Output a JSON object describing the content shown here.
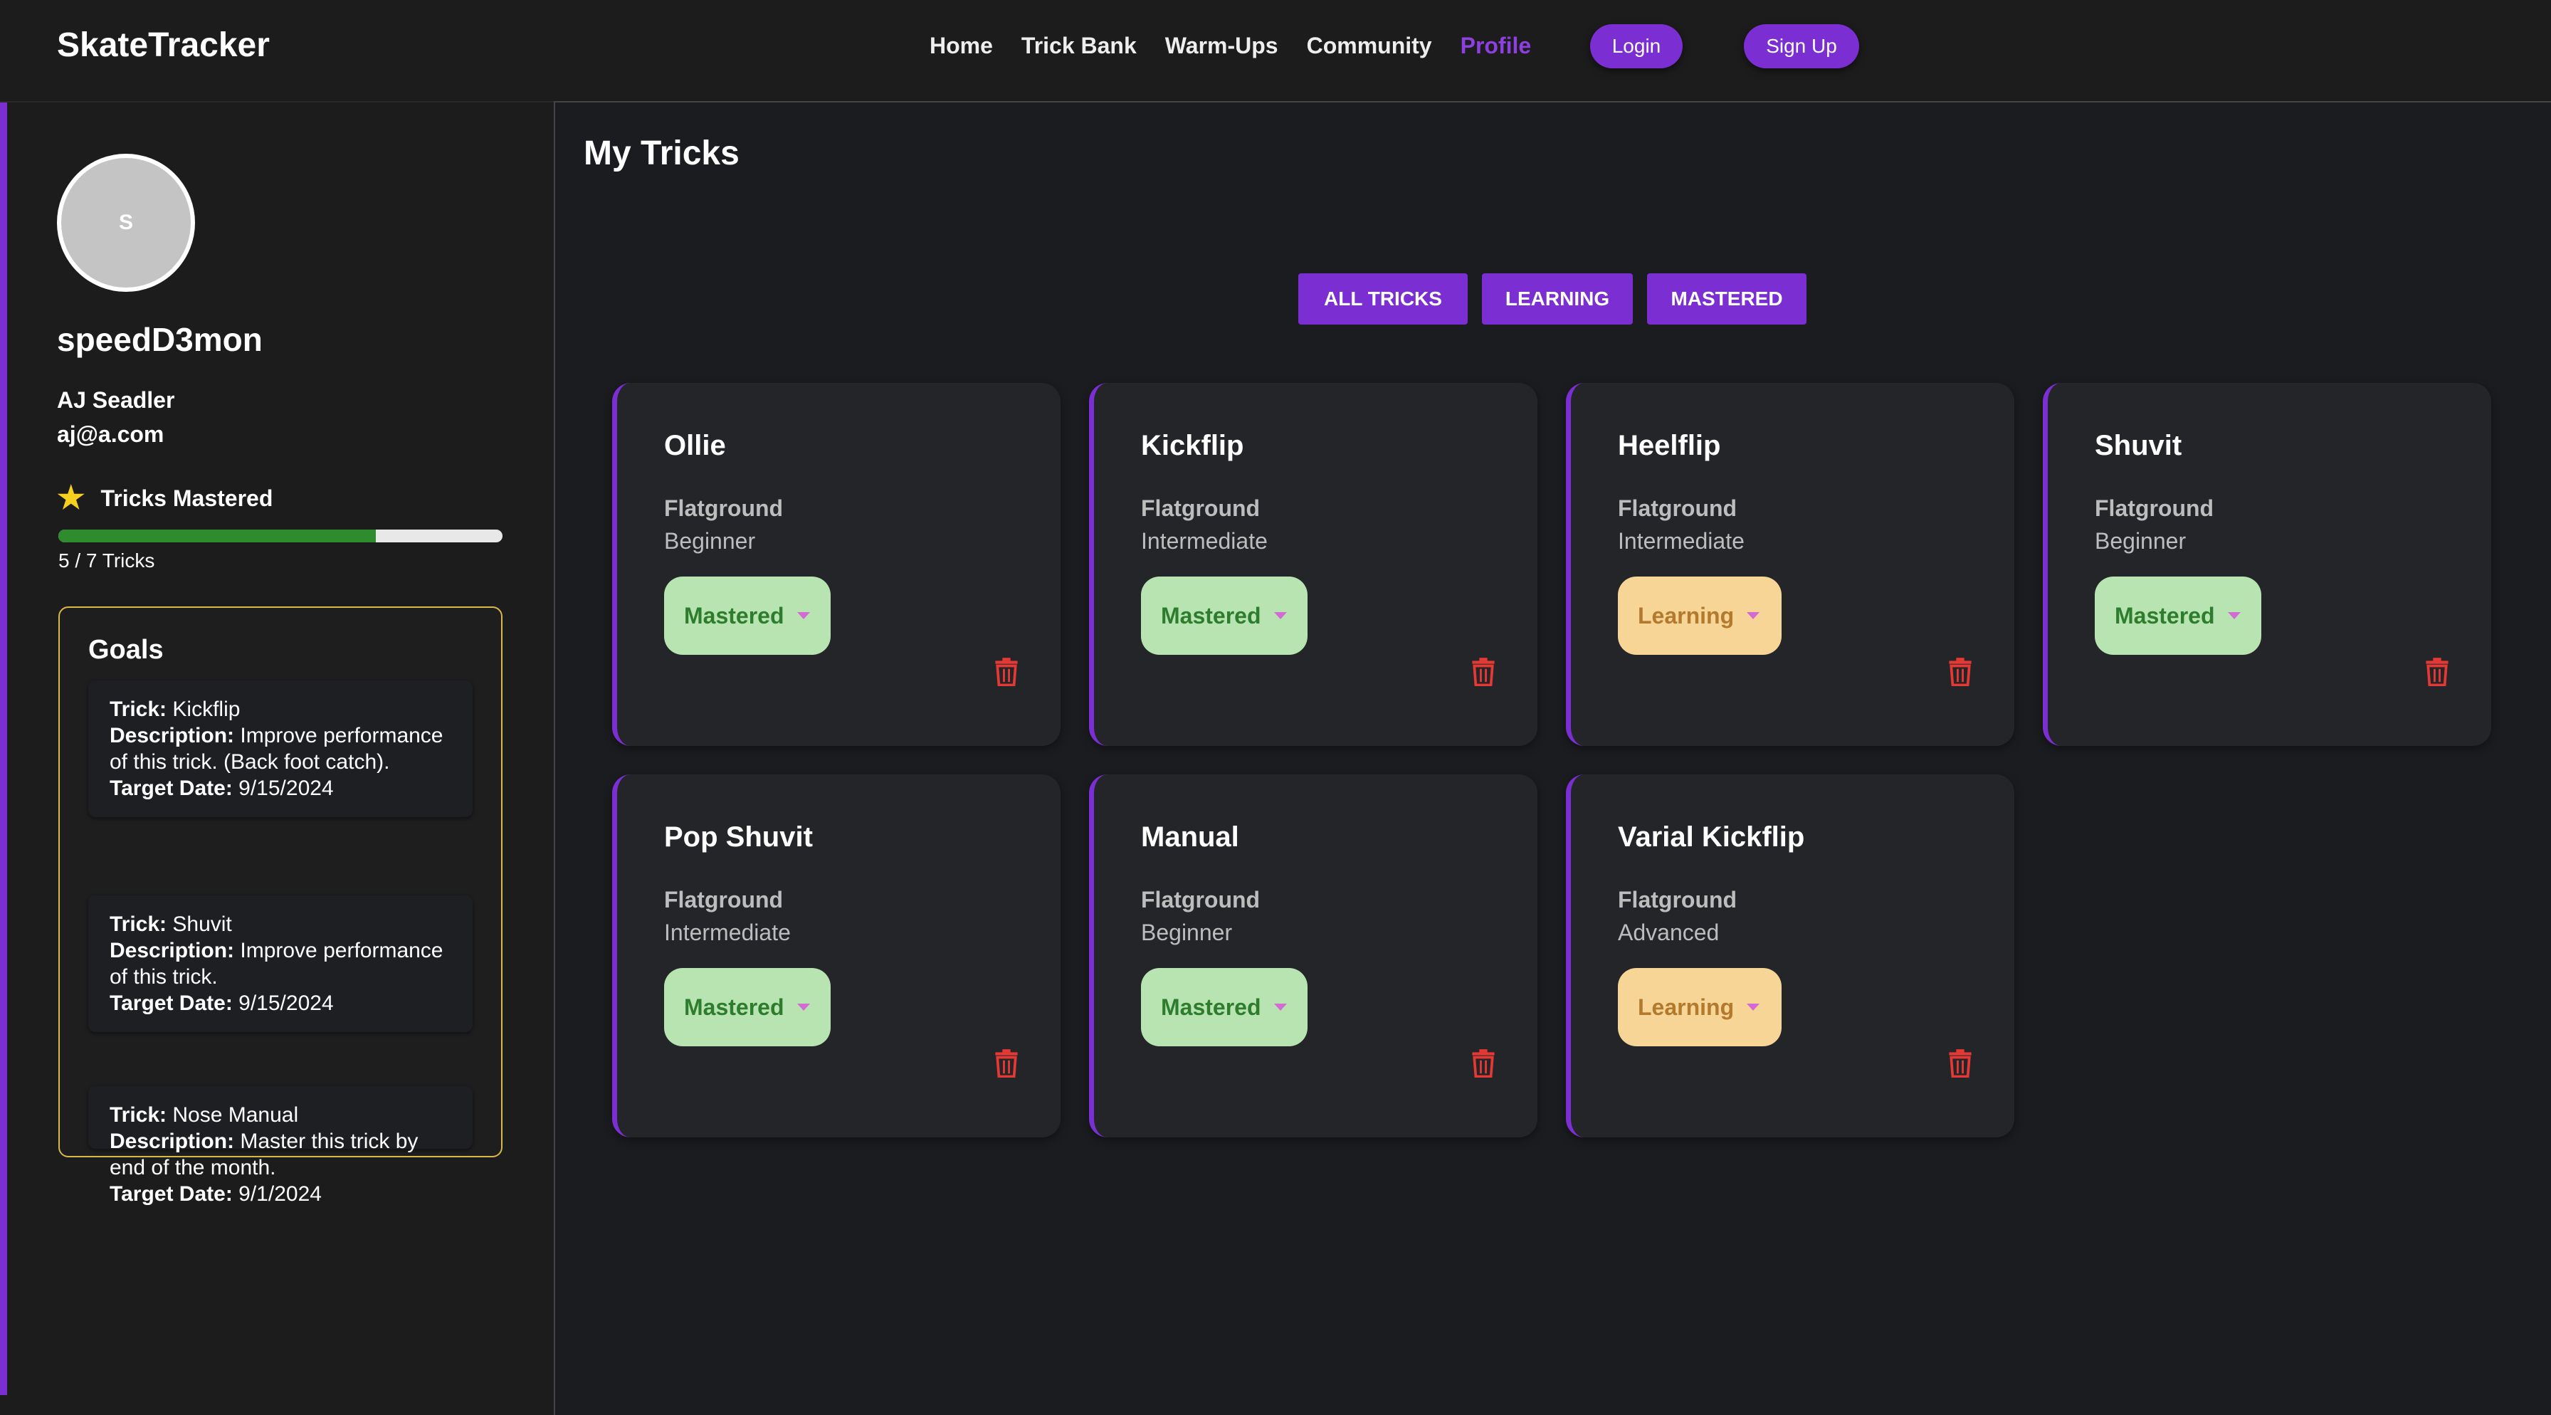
{
  "brand": "SkateTracker",
  "nav": [
    "Home",
    "Trick Bank",
    "Warm-Ups",
    "Community",
    "Profile"
  ],
  "auth": {
    "login": "Login",
    "signup": "Sign Up"
  },
  "profile": {
    "avatar_initial": "S",
    "username": "speedD3mon",
    "full_name": "AJ Seadler",
    "email": "aj@a.com",
    "mastered_label": "Tricks Mastered",
    "mastered_count": 5,
    "total_count": 7,
    "progress_text": "5 / 7 Tricks"
  },
  "goals": {
    "title": "Goals",
    "items": [
      {
        "trick": "Kickflip",
        "description": "Improve performance of this trick. (Back foot catch).",
        "target_date": "9/15/2024"
      },
      {
        "trick": "Shuvit",
        "description": "Improve performance of this trick.",
        "target_date": "9/15/2024"
      },
      {
        "trick": "Nose Manual",
        "description": "Master this trick by end of the month.",
        "target_date": "9/1/2024"
      }
    ],
    "labels": {
      "trick": "Trick:",
      "description": "Description:",
      "target_date": "Target Date:"
    }
  },
  "main": {
    "title": "My Tricks",
    "filters": [
      "ALL TRICKS",
      "LEARNING",
      "MASTERED"
    ]
  },
  "tricks": [
    {
      "name": "Ollie",
      "category": "Flatground",
      "level": "Beginner",
      "status": "Mastered"
    },
    {
      "name": "Kickflip",
      "category": "Flatground",
      "level": "Intermediate",
      "status": "Mastered"
    },
    {
      "name": "Heelflip",
      "category": "Flatground",
      "level": "Intermediate",
      "status": "Learning"
    },
    {
      "name": "Shuvit",
      "category": "Flatground",
      "level": "Beginner",
      "status": "Mastered"
    },
    {
      "name": "Pop Shuvit",
      "category": "Flatground",
      "level": "Intermediate",
      "status": "Mastered"
    },
    {
      "name": "Manual",
      "category": "Flatground",
      "level": "Beginner",
      "status": "Mastered"
    },
    {
      "name": "Varial Kickflip",
      "category": "Flatground",
      "level": "Advanced",
      "status": "Learning"
    }
  ],
  "icons": {
    "star": "star-icon",
    "trash": "trash-icon",
    "caret": "caret-down-icon"
  },
  "colors": {
    "accent": "#7b2fd2",
    "mastered_bg": "#b7e4b0",
    "learning_bg": "#f6d597",
    "trash": "#e53935",
    "progress": "#2e8b2e"
  }
}
